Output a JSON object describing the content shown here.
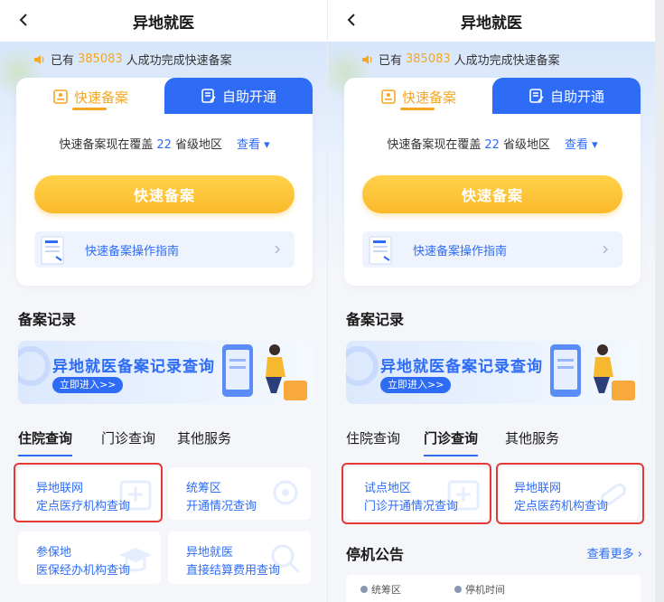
{
  "left": {
    "header": {
      "title": "异地就医"
    },
    "notice": {
      "prefix": "已有",
      "count": "385083",
      "suffix": "人成功完成快速备案"
    },
    "tabs": {
      "fast": "快速备案",
      "self": "自助开通"
    },
    "coverage": {
      "prefix": "快速备案现在覆盖",
      "count": "22",
      "suffix": "省级地区",
      "view": "查看 ▾"
    },
    "main_button": "快速备案",
    "guide": "快速备案操作指南",
    "record_title": "备案记录",
    "banner": {
      "headline": "异地就医备案记录查询",
      "enter": "立即进入>>"
    },
    "query_tabs": [
      "住院查询",
      "门诊查询",
      "其他服务"
    ],
    "services": [
      {
        "l1": "异地联网",
        "l2": "定点医疗机构查询"
      },
      {
        "l1": "统筹区",
        "l2": "开通情况查询"
      },
      {
        "l1": "参保地",
        "l2": "医保经办机构查询"
      },
      {
        "l1": "异地就医",
        "l2": "直接结算费用查询"
      }
    ]
  },
  "right": {
    "header": {
      "title": "异地就医"
    },
    "notice": {
      "prefix": "已有",
      "count": "385083",
      "suffix": "人成功完成快速备案"
    },
    "tabs": {
      "fast": "快速备案",
      "self": "自助开通"
    },
    "coverage": {
      "prefix": "快速备案现在覆盖",
      "count": "22",
      "suffix": "省级地区",
      "view": "查看 ▾"
    },
    "main_button": "快速备案",
    "guide": "快速备案操作指南",
    "record_title": "备案记录",
    "banner": {
      "headline": "异地就医备案记录查询",
      "enter": "立即进入>>"
    },
    "query_tabs": [
      "住院查询",
      "门诊查询",
      "其他服务"
    ],
    "services": [
      {
        "l1": "试点地区",
        "l2": "门诊开通情况查询"
      },
      {
        "l1": "异地联网",
        "l2": "定点医药机构查询"
      }
    ],
    "outage": {
      "title": "停机公告",
      "more": "查看更多",
      "columns": [
        "统筹区",
        "停机时间"
      ]
    }
  },
  "colors": {
    "primary": "#2e6cf6",
    "accent": "#f5a623",
    "highlight_box": "#e53935"
  }
}
